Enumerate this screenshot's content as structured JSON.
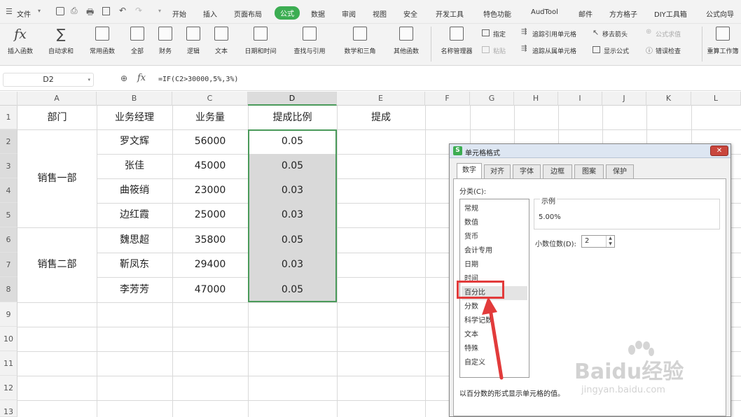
{
  "menu": {
    "file_label": "文件",
    "tabs": [
      "开始",
      "插入",
      "页面布局",
      "公式",
      "数据",
      "审阅",
      "视图",
      "安全",
      "开发工具",
      "特色功能",
      "AudTool",
      "邮件",
      "方方格子",
      "DIY工具箱",
      "公式向导"
    ]
  },
  "ribbon": {
    "buttons": [
      "插入函数",
      "自动求和",
      "常用函数",
      "全部",
      "财务",
      "逻辑",
      "文本",
      "日期和时间",
      "查找与引用",
      "数学和三角",
      "其他函数",
      "名称管理器"
    ],
    "small": {
      "specify": "指定",
      "paste": "粘贴",
      "trace_precedents": "追踪引用单元格",
      "trace_dependents": "追踪从属单元格",
      "remove_arrows": "移去箭头",
      "show_formula": "显示公式",
      "evaluate": "公式求值",
      "error_check": "错误检查",
      "recalc": "重算工作簿"
    }
  },
  "formula_bar": {
    "name_box": "D2",
    "fx": "fx",
    "formula": "=IF(C2>30000,5%,3%)"
  },
  "grid": {
    "columns": [
      "A",
      "B",
      "C",
      "D",
      "E",
      "F",
      "G",
      "H",
      "I",
      "J",
      "K",
      "L"
    ],
    "rows": [
      "1",
      "2",
      "3",
      "4",
      "5",
      "6",
      "7",
      "8",
      "9",
      "10",
      "11",
      "12",
      "13"
    ],
    "headers": [
      "部门",
      "业务经理",
      "业务量",
      "提成比例",
      "提成"
    ],
    "dept1": "销售一部",
    "dept2": "销售二部",
    "data": [
      {
        "manager": "罗文辉",
        "volume": "56000",
        "ratio": "0.05"
      },
      {
        "manager": "张佳",
        "volume": "45000",
        "ratio": "0.05"
      },
      {
        "manager": "曲筱绡",
        "volume": "23000",
        "ratio": "0.03"
      },
      {
        "manager": "边红霞",
        "volume": "25000",
        "ratio": "0.03"
      },
      {
        "manager": "魏思超",
        "volume": "35800",
        "ratio": "0.05"
      },
      {
        "manager": "靳凤东",
        "volume": "29400",
        "ratio": "0.03"
      },
      {
        "manager": "李芳芳",
        "volume": "47000",
        "ratio": "0.05"
      }
    ]
  },
  "dialog": {
    "title": "单元格格式",
    "tabs": [
      "数字",
      "对齐",
      "字体",
      "边框",
      "图案",
      "保护"
    ],
    "category_label": "分类(C):",
    "categories": [
      "常规",
      "数值",
      "货币",
      "会计专用",
      "日期",
      "时间",
      "百分比",
      "分数",
      "科学记数",
      "文本",
      "特殊",
      "自定义"
    ],
    "sample_label": "示例",
    "sample_value": "5.00%",
    "decimals_label": "小数位数(D):",
    "decimals_value": "2",
    "description": "以百分数的形式显示单元格的值。"
  },
  "watermark": {
    "brand": "Baidu经验",
    "url": "jingyan.baidu.com"
  },
  "colors": {
    "accent_green": "#3cad52",
    "selection_border": "#4a9a5a",
    "highlight_red": "#e23b3b",
    "selected_fill": "#d9d9d9"
  }
}
